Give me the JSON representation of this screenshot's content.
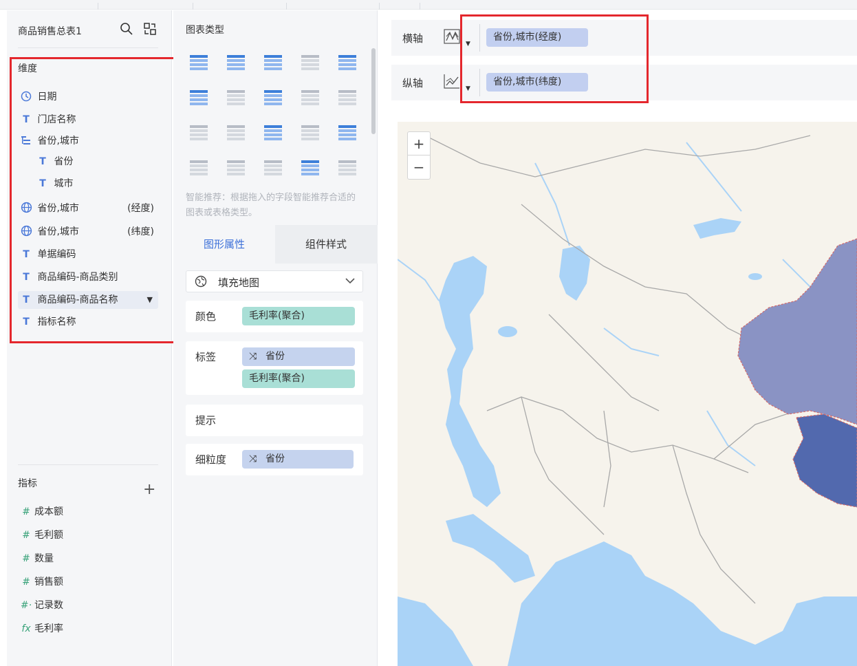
{
  "left": {
    "dataset_title": "商品销售总表1",
    "dimension_title": "维度",
    "dimensions": [
      {
        "type": "clock-icon",
        "label": "日期",
        "suffix": ""
      },
      {
        "type": "text-type-icon",
        "label": "门店名称",
        "suffix": ""
      },
      {
        "type": "hierarchy-icon",
        "label": "省份,城市",
        "suffix": ""
      },
      {
        "type": "text-type-icon",
        "label": "省份",
        "suffix": ""
      },
      {
        "type": "text-type-icon",
        "label": "城市",
        "suffix": ""
      },
      {
        "type": "globe-icon",
        "label": "省份,城市",
        "suffix": "(经度)"
      },
      {
        "type": "globe-icon",
        "label": "省份,城市",
        "suffix": "(纬度)"
      },
      {
        "type": "text-type-icon",
        "label": "单据编码",
        "suffix": ""
      },
      {
        "type": "text-type-icon",
        "label": "商品编码-商品类别",
        "suffix": ""
      },
      {
        "type": "text-type-icon",
        "label": "商品编码-商品名称",
        "suffix": ""
      },
      {
        "type": "text-type-icon",
        "label": "指标名称",
        "suffix": ""
      }
    ],
    "measure_title": "指标",
    "measures": [
      {
        "glyph": "#",
        "label": "成本额"
      },
      {
        "glyph": "#",
        "label": "毛利额"
      },
      {
        "glyph": "#",
        "label": "数量"
      },
      {
        "glyph": "#",
        "label": "销售额"
      },
      {
        "glyph": "#·",
        "label": "记录数"
      },
      {
        "glyph": "fx",
        "label": "毛利率"
      }
    ]
  },
  "middle": {
    "chart_type_title": "图表类型",
    "smart_tip": "智能推荐：根据拖入的字段智能推荐合适的图表或表格类型。",
    "tabs": [
      "图形属性",
      "组件样式"
    ],
    "chart_select": "填充地图",
    "color_label": "颜色",
    "color_pill": "毛利率(聚合)",
    "tag_label": "标签",
    "tag_pills": [
      "省份",
      "毛利率(聚合)"
    ],
    "hint_label": "提示",
    "granularity_label": "细粒度",
    "granularity_pill": "省份"
  },
  "right": {
    "x_axis_label": "横轴",
    "x_axis_field": "省份,城市(经度)",
    "y_axis_label": "纵轴",
    "y_axis_field": "省份,城市(纬度)",
    "zoom_in": "+",
    "zoom_out": "−"
  },
  "colors": {
    "accent": "#3b6fd8",
    "highlight_red": "#e4272d",
    "map_water": "#aad3f7",
    "map_land": "#f6f3ec",
    "region_light": "#8a93c4",
    "region_dark": "#5269ae"
  }
}
